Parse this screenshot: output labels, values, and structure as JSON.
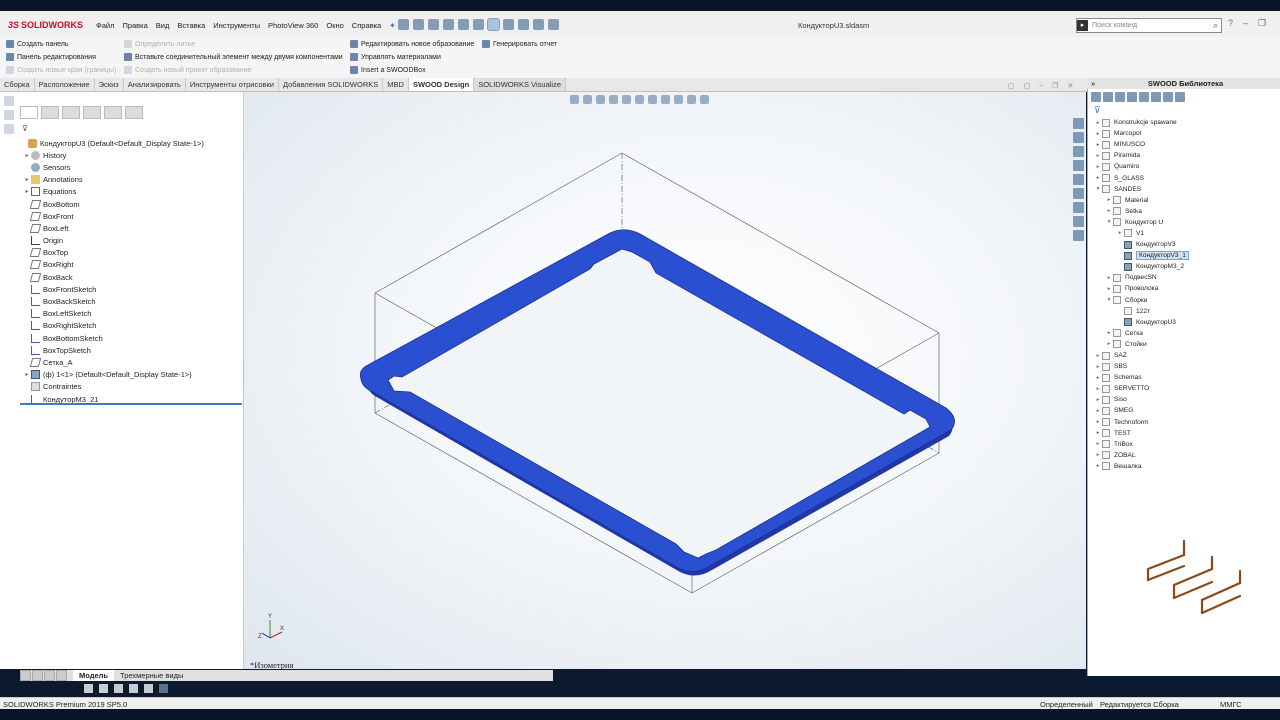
{
  "app": {
    "name": "SOLIDWORKS",
    "document_title": "КондукторU3.sldasm",
    "menu": [
      "Файл",
      "Правка",
      "Вид",
      "Вставка",
      "Инструменты",
      "PhotoView 360",
      "Окно",
      "Справка"
    ],
    "search_placeholder": "Поиск команд"
  },
  "command_manager": {
    "col1": [
      "Создать панель",
      "Панель редактирования",
      "Создать новые края (границы)"
    ],
    "col2": [
      "Определить литье",
      "Вставьте соединительный элемент между двумя компонентами",
      "Создать новый проект образование"
    ],
    "col3": [
      "Редактировать новое образование",
      "Управлять материалами",
      "Insert a SWOODBox"
    ],
    "col4": [
      "Генерировать отчет"
    ]
  },
  "tabs": [
    "Сборка",
    "Расположение",
    "Эскиз",
    "Анализировать",
    "Инструменты отрисовки",
    "Добавления SOLIDWORKS",
    "MBD",
    "SWOOD Design",
    "SOLIDWORKS Visualize"
  ],
  "active_tab": "SWOOD Design",
  "feature_tree": {
    "root": "КондукторU3  (Default<Default_Display State-1>)",
    "items": [
      {
        "label": "History",
        "icon": "history-icon",
        "exp": "▸"
      },
      {
        "label": "Sensors",
        "icon": "sensor-icon",
        "exp": ""
      },
      {
        "label": "Annotations",
        "icon": "annotations-icon",
        "exp": "▸"
      },
      {
        "label": "Equations",
        "icon": "equations-icon",
        "exp": "▸"
      },
      {
        "label": "BoxBottom",
        "icon": "plane-icon",
        "exp": ""
      },
      {
        "label": "BoxFront",
        "icon": "plane-icon",
        "exp": ""
      },
      {
        "label": "BoxLeft",
        "icon": "plane-icon",
        "exp": ""
      },
      {
        "label": "Origin",
        "icon": "origin-icon",
        "exp": ""
      },
      {
        "label": "BoxTop",
        "icon": "plane-icon",
        "exp": ""
      },
      {
        "label": "BoxRight",
        "icon": "plane-icon",
        "exp": ""
      },
      {
        "label": "BoxBack",
        "icon": "plane-icon",
        "exp": ""
      },
      {
        "label": "BoxFrontSketch",
        "icon": "sketch-icon",
        "exp": ""
      },
      {
        "label": "BoxBackSketch",
        "icon": "sketch-icon",
        "exp": ""
      },
      {
        "label": "BoxLeftSketch",
        "icon": "sketch-icon",
        "exp": ""
      },
      {
        "label": "BoxRightSketch",
        "icon": "sketch-icon",
        "exp": ""
      },
      {
        "label": "BoxBottomSketch",
        "icon": "sketch-icon",
        "exp": ""
      },
      {
        "label": "BoxTopSketch",
        "icon": "sketch-icon",
        "exp": ""
      },
      {
        "label": "Сетка_А",
        "icon": "plane-icon",
        "exp": ""
      },
      {
        "label": "(ф) 1<1> (Default<Default_Display State-1>)",
        "icon": "part-icon",
        "exp": "▸"
      },
      {
        "label": "Contraintes",
        "icon": "constraints-icon",
        "exp": ""
      },
      {
        "label": "КондуторМ3_21",
        "icon": "sketch-icon",
        "exp": ""
      }
    ]
  },
  "bottom_tabs": [
    "Модель",
    "Трехмерные виды"
  ],
  "viewport": {
    "view_label": "*Изометрия",
    "model_color": "#2a4fd0",
    "axis_labels": [
      "Y",
      "X",
      "Z"
    ]
  },
  "library": {
    "title": "SWOOD Библиотека",
    "items": [
      {
        "label": "Konstrukcje spawane",
        "depth": 0,
        "exp": "▸",
        "asm": false,
        "sel": false
      },
      {
        "label": "Marcopol",
        "depth": 0,
        "exp": "▸",
        "asm": false,
        "sel": false
      },
      {
        "label": "MINUSCO",
        "depth": 0,
        "exp": "▸",
        "asm": false,
        "sel": false
      },
      {
        "label": "Piramida",
        "depth": 0,
        "exp": "▸",
        "asm": false,
        "sel": false
      },
      {
        "label": "Quamiro",
        "depth": 0,
        "exp": "▸",
        "asm": false,
        "sel": false
      },
      {
        "label": "S_GLASS",
        "depth": 0,
        "exp": "▸",
        "asm": false,
        "sel": false
      },
      {
        "label": "SANDES",
        "depth": 0,
        "exp": "▾",
        "asm": false,
        "sel": false
      },
      {
        "label": "Material",
        "depth": 1,
        "exp": "▸",
        "asm": false,
        "sel": false
      },
      {
        "label": "Setka",
        "depth": 1,
        "exp": "▸",
        "asm": false,
        "sel": false
      },
      {
        "label": "Кондуктор U",
        "depth": 1,
        "exp": "▾",
        "asm": false,
        "sel": false
      },
      {
        "label": "V1",
        "depth": 2,
        "exp": "▸",
        "asm": false,
        "sel": false
      },
      {
        "label": "КондукторV3",
        "depth": 2,
        "exp": "",
        "asm": true,
        "sel": false
      },
      {
        "label": "КондукторV3_1",
        "depth": 2,
        "exp": "",
        "asm": true,
        "sel": true
      },
      {
        "label": "КондукторМ3_2",
        "depth": 2,
        "exp": "",
        "asm": true,
        "sel": false
      },
      {
        "label": "ПодвесSN",
        "depth": 1,
        "exp": "▸",
        "asm": false,
        "sel": false
      },
      {
        "label": "Проволока",
        "depth": 1,
        "exp": "▸",
        "asm": false,
        "sel": false
      },
      {
        "label": "Сборки",
        "depth": 1,
        "exp": "▾",
        "asm": false,
        "sel": false
      },
      {
        "label": "122т",
        "depth": 2,
        "exp": "",
        "asm": false,
        "sel": false
      },
      {
        "label": "КондукторU3",
        "depth": 2,
        "exp": "",
        "asm": true,
        "sel": false
      },
      {
        "label": "Сетка",
        "depth": 1,
        "exp": "▸",
        "asm": false,
        "sel": false
      },
      {
        "label": "Стойки",
        "depth": 1,
        "exp": "▸",
        "asm": false,
        "sel": false
      },
      {
        "label": "SAZ",
        "depth": 0,
        "exp": "▸",
        "asm": false,
        "sel": false
      },
      {
        "label": "SBS",
        "depth": 0,
        "exp": "▸",
        "asm": false,
        "sel": false
      },
      {
        "label": "Schemas",
        "depth": 0,
        "exp": "▸",
        "asm": false,
        "sel": false
      },
      {
        "label": "SERVETTO",
        "depth": 0,
        "exp": "▸",
        "asm": false,
        "sel": false
      },
      {
        "label": "Siso",
        "depth": 0,
        "exp": "▸",
        "asm": false,
        "sel": false
      },
      {
        "label": "SMEG",
        "depth": 0,
        "exp": "▸",
        "asm": false,
        "sel": false
      },
      {
        "label": "Technoform",
        "depth": 0,
        "exp": "▸",
        "asm": false,
        "sel": false
      },
      {
        "label": "TEST",
        "depth": 0,
        "exp": "▸",
        "asm": false,
        "sel": false
      },
      {
        "label": "TriBox",
        "depth": 0,
        "exp": "▸",
        "asm": false,
        "sel": false
      },
      {
        "label": "ZOBAL",
        "depth": 0,
        "exp": "▸",
        "asm": false,
        "sel": false
      },
      {
        "label": "Вешалка",
        "depth": 0,
        "exp": "▸",
        "asm": false,
        "sel": false
      }
    ]
  },
  "status": {
    "version": "SOLIDWORKS Premium 2019 SP5.0",
    "state": "Определенный",
    "editing": "Редактируется Сборка",
    "units": "ММГС"
  }
}
